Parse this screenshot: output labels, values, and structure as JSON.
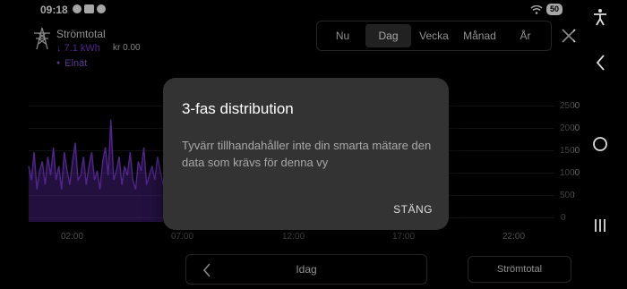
{
  "status_bar": {
    "time": "09:18",
    "battery": "50",
    "icons": [
      "facebook-icon",
      "messenger-icon",
      "facebook-icon"
    ]
  },
  "device": {
    "name": "Strömtotal",
    "power": "↓ 7.1 kWh",
    "cost": "kr 0.00",
    "source": "Elnät",
    "accent_color": "#7b3ad8"
  },
  "period_tabs": [
    {
      "label": "Nu"
    },
    {
      "label": "Dag",
      "active": true
    },
    {
      "label": "Vecka"
    },
    {
      "label": "Månad"
    },
    {
      "label": "År"
    }
  ],
  "chart_data": {
    "type": "area",
    "y_ticks": [
      "2500",
      "2000",
      "1500",
      "1000",
      "500",
      "0"
    ],
    "ylim": [
      0,
      2500
    ],
    "x_ticks": [
      "02:00",
      "07:00",
      "12:00",
      "17:00",
      "22:00"
    ],
    "color": "#7b3ad8",
    "series": [
      {
        "values": [
          1200,
          900,
          1500,
          700,
          1100,
          1300,
          800,
          1400,
          1000,
          1600,
          900,
          1200,
          700,
          1500,
          1100,
          800,
          1300,
          1700,
          900,
          1000,
          1400,
          800,
          1200,
          1500,
          900,
          1100,
          700,
          1300,
          1600,
          1000,
          2200,
          900,
          1100,
          1400,
          800,
          1200,
          1000,
          1500,
          900,
          700,
          1300,
          1100,
          1600,
          800,
          1000,
          1200,
          900,
          1400,
          1100,
          800
        ]
      }
    ]
  },
  "bottom": {
    "date_label": "Idag",
    "meter_label": "Strömtotal"
  },
  "dialog": {
    "title": "3-fas distribution",
    "body": "Tyvärr tillhandahåller inte din smarta mätare den data som krävs för denna vy",
    "action": "STÄNG"
  }
}
